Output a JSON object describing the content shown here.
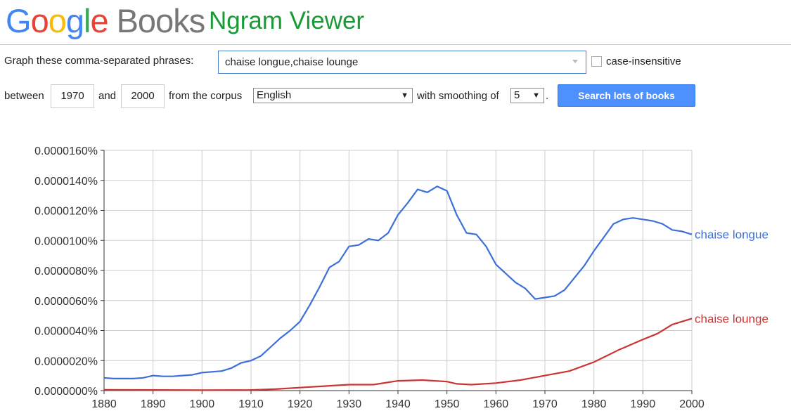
{
  "header": {
    "logo_text": "Google",
    "books_text": "Books",
    "title": "Ngram Viewer"
  },
  "form": {
    "phrases_label": "Graph these comma-separated phrases:",
    "query_value": "chaise longue,chaise lounge",
    "case_insensitive_label": "case-insensitive",
    "case_insensitive_checked": false,
    "between_label": "between",
    "start_year": "1970",
    "and_label": "and",
    "end_year": "2000",
    "corpus_label": "from the corpus",
    "corpus_value": "English",
    "smoothing_label": "with smoothing of",
    "smoothing_value": "5",
    "period": ".",
    "search_button": "Search lots of books",
    "button_color": "#4d90fe"
  },
  "chart_data": {
    "type": "line",
    "xlim": [
      1880,
      2000
    ],
    "ylim": [
      0,
      1.6e-06
    ],
    "x_ticks": [
      1880,
      1890,
      1900,
      1910,
      1920,
      1930,
      1940,
      1950,
      1960,
      1970,
      1980,
      1990,
      2000
    ],
    "y_ticks": [
      "0.0000000%",
      "0.0000020%",
      "0.0000040%",
      "0.0000060%",
      "0.0000080%",
      "0.0000100%",
      "0.0000120%",
      "0.0000140%",
      "0.0000160%"
    ],
    "y_tick_values": [
      0,
      2e-07,
      4e-07,
      6e-07,
      8e-07,
      1e-06,
      1.2e-06,
      1.4e-06,
      1.6e-06
    ],
    "grid": true,
    "legend": "right-end-labels",
    "series": [
      {
        "name": "chaise longue",
        "color": "#3d6fdb",
        "x": [
          1880,
          1882,
          1884,
          1886,
          1888,
          1890,
          1892,
          1894,
          1896,
          1898,
          1900,
          1902,
          1904,
          1906,
          1908,
          1910,
          1912,
          1914,
          1916,
          1918,
          1920,
          1922,
          1924,
          1926,
          1928,
          1930,
          1932,
          1934,
          1936,
          1938,
          1940,
          1942,
          1944,
          1946,
          1948,
          1950,
          1952,
          1954,
          1956,
          1958,
          1960,
          1962,
          1964,
          1966,
          1968,
          1970,
          1972,
          1974,
          1976,
          1978,
          1980,
          1982,
          1984,
          1986,
          1988,
          1990,
          1992,
          1994,
          1996,
          1998,
          2000
        ],
        "values": [
          8.5e-08,
          8e-08,
          8e-08,
          8e-08,
          8.5e-08,
          1e-07,
          9.5e-08,
          9.5e-08,
          1e-07,
          1.05e-07,
          1.2e-07,
          1.25e-07,
          1.3e-07,
          1.5e-07,
          1.85e-07,
          2e-07,
          2.3e-07,
          2.9e-07,
          3.5e-07,
          4e-07,
          4.6e-07,
          5.7e-07,
          6.9e-07,
          8.2e-07,
          8.6e-07,
          9.6e-07,
          9.7e-07,
          1.01e-06,
          1e-06,
          1.05e-06,
          1.17e-06,
          1.25e-06,
          1.34e-06,
          1.32e-06,
          1.36e-06,
          1.33e-06,
          1.17e-06,
          1.05e-06,
          1.04e-06,
          9.6e-07,
          8.4e-07,
          7.8e-07,
          7.2e-07,
          6.8e-07,
          6.1e-07,
          6.2e-07,
          6.3e-07,
          6.7e-07,
          7.5e-07,
          8.3e-07,
          9.3e-07,
          1.02e-06,
          1.11e-06,
          1.14e-06,
          1.15e-06,
          1.14e-06,
          1.13e-06,
          1.11e-06,
          1.07e-06,
          1.06e-06,
          1.04e-06
        ]
      },
      {
        "name": "chaise lounge",
        "color": "#cc3333",
        "x": [
          1880,
          1890,
          1900,
          1910,
          1915,
          1920,
          1925,
          1930,
          1935,
          1940,
          1945,
          1950,
          1952,
          1955,
          1960,
          1965,
          1970,
          1975,
          1980,
          1985,
          1990,
          1993,
          1996,
          2000
        ],
        "values": [
          5e-09,
          4e-09,
          3e-09,
          4e-09,
          1e-08,
          2e-08,
          3e-08,
          4e-08,
          4e-08,
          6.5e-08,
          7e-08,
          6e-08,
          4.5e-08,
          4e-08,
          5e-08,
          7e-08,
          1e-07,
          1.3e-07,
          1.9e-07,
          2.7e-07,
          3.4e-07,
          3.8e-07,
          4.4e-07,
          4.8e-07
        ]
      }
    ]
  }
}
